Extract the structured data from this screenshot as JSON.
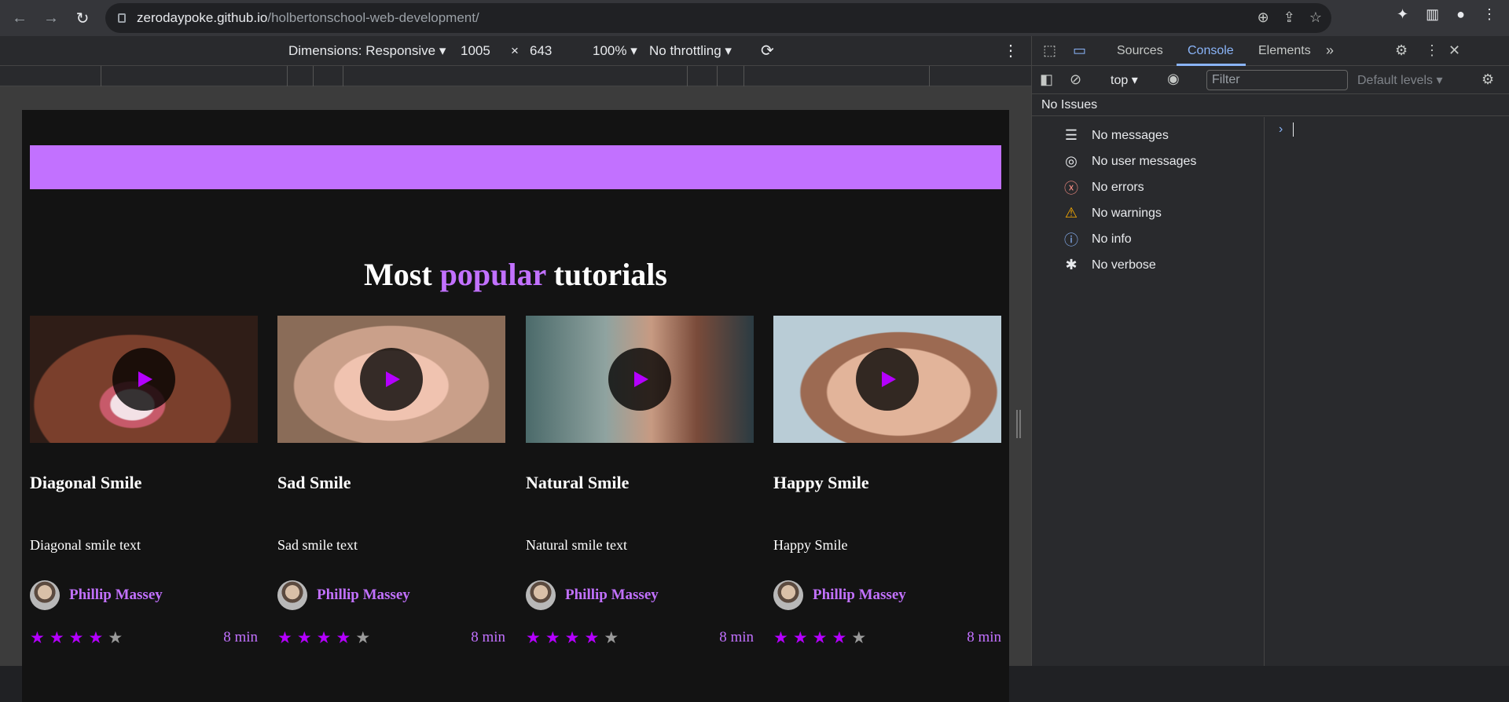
{
  "browser": {
    "url_host": "zerodaypoke.github.io",
    "url_path": "/holbertonschool-web-development/"
  },
  "device_toolbar": {
    "dimensions_label": "Dimensions: Responsive",
    "width": "1005",
    "times": "×",
    "height": "643",
    "zoom": "100%",
    "throttling": "No throttling"
  },
  "page": {
    "title_before": "Most",
    "title_accent": "popular",
    "title_after": "tutorials",
    "accent_color": "#c271ff",
    "cards": [
      {
        "title": "Diagonal Smile",
        "text": "Diagonal smile text",
        "author": "Phillip Massey",
        "rating": 4,
        "max_rating": 5,
        "duration": "8 min"
      },
      {
        "title": "Sad Smile",
        "text": "Sad smile text",
        "author": "Phillip Massey",
        "rating": 4,
        "max_rating": 5,
        "duration": "8 min"
      },
      {
        "title": "Natural Smile",
        "text": "Natural smile text",
        "author": "Phillip Massey",
        "rating": 4,
        "max_rating": 5,
        "duration": "8 min"
      },
      {
        "title": "Happy Smile",
        "text": "Happy Smile",
        "author": "Phillip Massey",
        "rating": 4,
        "max_rating": 5,
        "duration": "8 min"
      }
    ]
  },
  "devtools": {
    "tabs": [
      "Sources",
      "Console",
      "Elements"
    ],
    "active_tab": "Console",
    "context": "top",
    "filter_placeholder": "Filter",
    "levels": "Default levels",
    "issues": "No Issues",
    "sidebar": [
      {
        "icon": "list-icon",
        "label": "No messages"
      },
      {
        "icon": "user-icon",
        "label": "No user messages"
      },
      {
        "icon": "error-icon",
        "label": "No errors"
      },
      {
        "icon": "warning-icon",
        "label": "No warnings"
      },
      {
        "icon": "info-icon",
        "label": "No info"
      },
      {
        "icon": "bug-icon",
        "label": "No verbose"
      }
    ]
  }
}
